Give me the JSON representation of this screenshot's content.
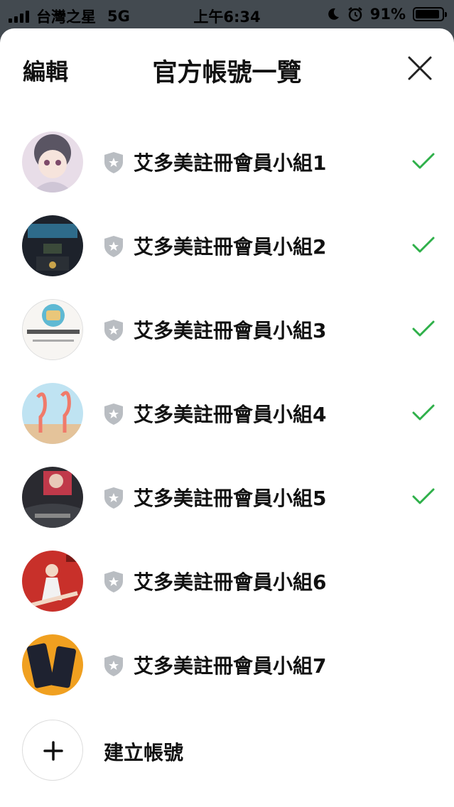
{
  "status_bar": {
    "carrier": "台灣之星",
    "network": "5G",
    "time": "上午6:34",
    "battery": "91%",
    "battery_level": 0.91
  },
  "header": {
    "edit_label": "編輯",
    "title": "官方帳號一覽"
  },
  "accounts": [
    {
      "name": "艾多美註冊會員小組1",
      "checked": true
    },
    {
      "name": "艾多美註冊會員小組2",
      "checked": true
    },
    {
      "name": "艾多美註冊會員小組3",
      "checked": true
    },
    {
      "name": "艾多美註冊會員小組4",
      "checked": true
    },
    {
      "name": "艾多美註冊會員小組5",
      "checked": true
    },
    {
      "name": "艾多美註冊會員小組6",
      "checked": false
    },
    {
      "name": "艾多美註冊會員小組7",
      "checked": false
    }
  ],
  "create": {
    "label": "建立帳號"
  },
  "colors": {
    "check": "#2fb04a",
    "shield": "#b9bdc2",
    "backdrop": "#434a50"
  }
}
